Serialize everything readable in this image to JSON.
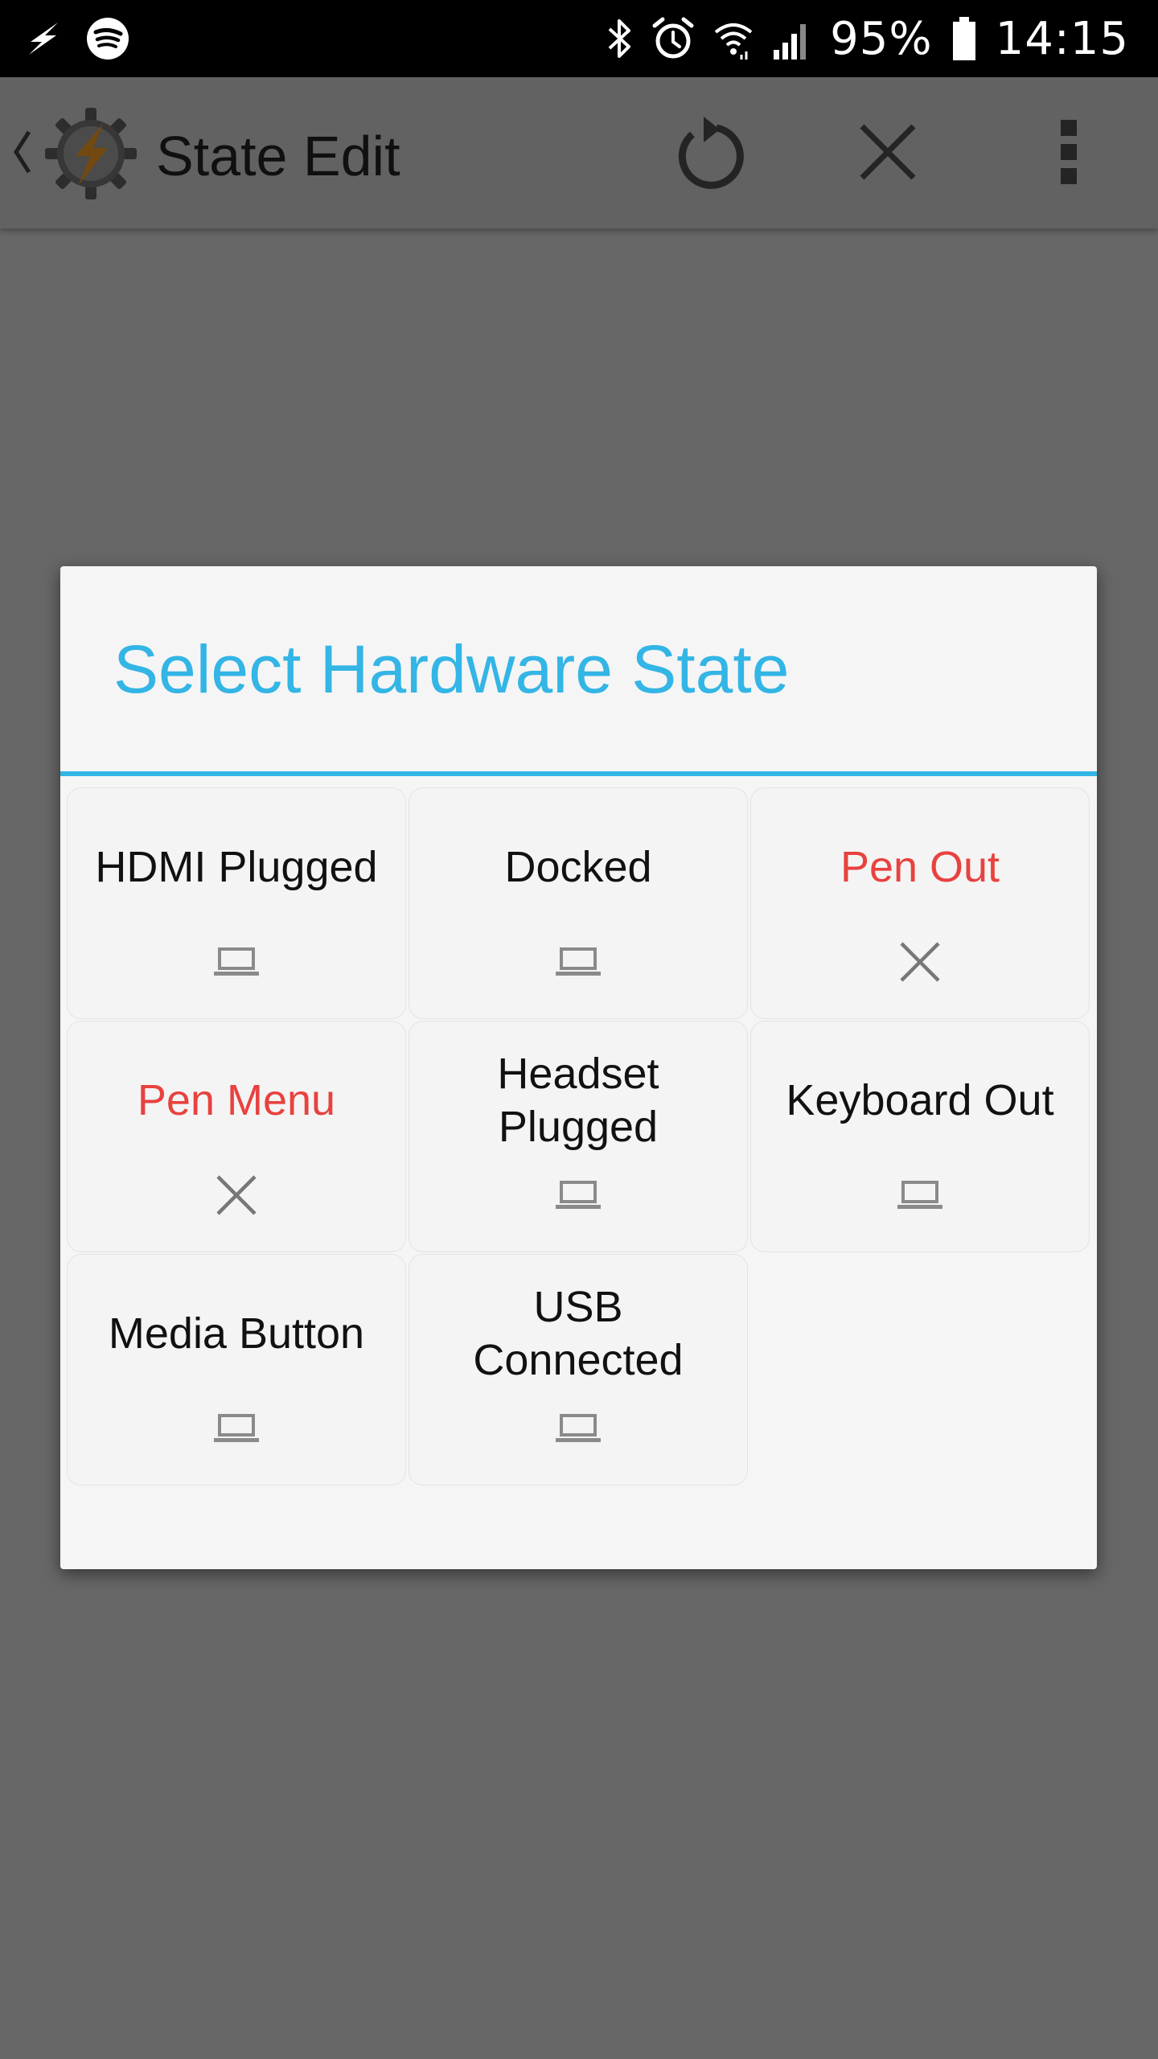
{
  "status_bar": {
    "left_icons": [
      "flash-icon",
      "spotify-icon"
    ],
    "right_icons": [
      "bluetooth-icon",
      "alarm-icon",
      "wifi-icon",
      "cell-signal-icon"
    ],
    "battery_percent": "95%",
    "battery_level": 0.95,
    "time": "14:15"
  },
  "app_bar": {
    "title": "State Edit",
    "actions": [
      "revert-icon",
      "cancel-icon",
      "overflow-menu-icon"
    ]
  },
  "dialog": {
    "title": "Select Hardware State",
    "accent_color": "#33b5e5",
    "warning_color": "#e8423f",
    "items": [
      {
        "label": "HDMI Plugged",
        "icon": "laptop-icon",
        "unavailable": false
      },
      {
        "label": "Docked",
        "icon": "laptop-icon",
        "unavailable": false
      },
      {
        "label": "Pen Out",
        "icon": "close-icon",
        "unavailable": true
      },
      {
        "label": "Pen Menu",
        "icon": "close-icon",
        "unavailable": true
      },
      {
        "label": "Headset Plugged",
        "icon": "laptop-icon",
        "unavailable": false
      },
      {
        "label": "Keyboard Out",
        "icon": "laptop-icon",
        "unavailable": false
      },
      {
        "label": "Media Button",
        "icon": "laptop-icon",
        "unavailable": false
      },
      {
        "label": "USB Connected",
        "icon": "laptop-icon",
        "unavailable": false
      }
    ]
  }
}
